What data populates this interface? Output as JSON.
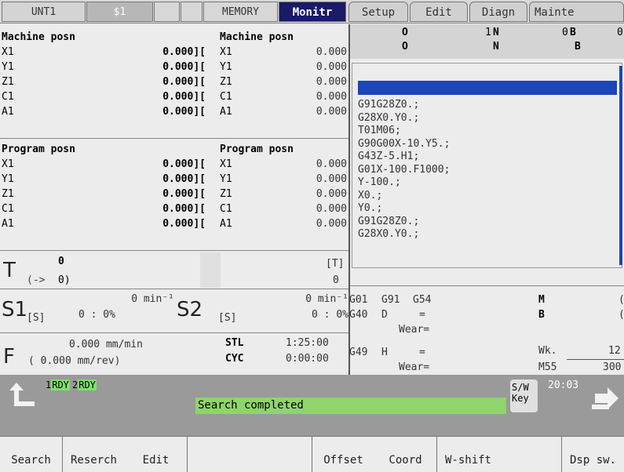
{
  "tabs": {
    "unit": "UNT1",
    "system": "$1",
    "mode": "MEMORY",
    "monitor": "Monitr",
    "setup": "Setup",
    "edit": "Edit",
    "diagn": "Diagn",
    "mainte": "Mainte"
  },
  "machine_posn_left": {
    "title": "Machine posn",
    "axes": [
      {
        "name": "X1",
        "value": "0.000]["
      },
      {
        "name": "Y1",
        "value": "0.000]["
      },
      {
        "name": "Z1",
        "value": "0.000]["
      },
      {
        "name": "C1",
        "value": "0.000]["
      },
      {
        "name": "A1",
        "value": "0.000]["
      }
    ]
  },
  "machine_posn_right": {
    "title": "Machine posn",
    "axes": [
      {
        "name": "X1",
        "value": "0.000"
      },
      {
        "name": "Y1",
        "value": "0.000"
      },
      {
        "name": "Z1",
        "value": "0.000"
      },
      {
        "name": "C1",
        "value": "0.000"
      },
      {
        "name": "A1",
        "value": "0.000"
      }
    ]
  },
  "program_posn_left": {
    "title": "Program posn",
    "axes": [
      {
        "name": "X1",
        "value": "0.000]["
      },
      {
        "name": "Y1",
        "value": "0.000]["
      },
      {
        "name": "Z1",
        "value": "0.000]["
      },
      {
        "name": "C1",
        "value": "0.000]["
      },
      {
        "name": "A1",
        "value": "0.000]["
      }
    ]
  },
  "program_posn_right": {
    "title": "Program posn",
    "axes": [
      {
        "name": "X1",
        "value": "0.000"
      },
      {
        "name": "Y1",
        "value": "0.000"
      },
      {
        "name": "Z1",
        "value": "0.000"
      },
      {
        "name": "C1",
        "value": "0.000"
      },
      {
        "name": "A1",
        "value": "0.000"
      }
    ]
  },
  "program_header": {
    "o_label": "O",
    "o_value": "1",
    "n_label": "N",
    "n_value": "0",
    "b_label": "B",
    "b_value": "0",
    "o2_label": "O",
    "n2_label": "N",
    "b2_label": "B"
  },
  "program_lines": [
    "G91G28Z0.;",
    "G28X0.Y0.;",
    "T01M06;",
    "G90G00X-10.Y5.;",
    "G43Z-5.H1;",
    "G01X-100.F1000;",
    "Y-100.;",
    "X0.;",
    "Y0.;",
    "G91G28Z0.;",
    "G28X0.Y0.;"
  ],
  "tool": {
    "label": "T",
    "value": "0",
    "arrow": "(->",
    "next": "0)",
    "bracket_label": "[T]",
    "bracket_value": "0"
  },
  "spindle": {
    "s1_label": "S1",
    "s1_rpm": "0 min⁻¹",
    "s1_bracket": "[S]",
    "s1_load": "0 :  0%",
    "s2_label": "S2",
    "s2_rpm": "0 min⁻¹",
    "s2_bracket": "[S]",
    "s2_load": "0 :  0%"
  },
  "feed": {
    "label": "F",
    "per_min": "0.000 mm/min",
    "per_rev": "( 0.000   mm/rev)",
    "stl_label": "STL",
    "stl_value": "1:25:00",
    "cyc_label": "CYC",
    "cyc_value": "0:00:00"
  },
  "modal": {
    "g01": "G01",
    "g91": "G91",
    "g54": "G54",
    "g40": "G40",
    "d_label": "D",
    "d_eq": "=",
    "wear1": "Wear=",
    "g49": "G49",
    "h_label": "H",
    "h_eq": "=",
    "wear2": "Wear=",
    "m_label": "M",
    "m_value": "(",
    "b_label": "B",
    "b_value": "(",
    "wk_label": "Wk.",
    "wk_value": "12",
    "m55_label": "M55",
    "m55_value": "300"
  },
  "status": {
    "rdy1": "RDY",
    "rdy1_num": "1",
    "rdy2": "RDY",
    "rdy2_num": "2",
    "message": "Search completed",
    "sw_key": "S/W\nKey",
    "sw_line1": "S/W",
    "sw_line2": "Key",
    "time": "20:03"
  },
  "softkeys": [
    "Search",
    "Reserch",
    "Edit",
    "",
    "",
    "Offset",
    "Coord",
    "W-shift",
    "",
    "Dsp sw."
  ]
}
